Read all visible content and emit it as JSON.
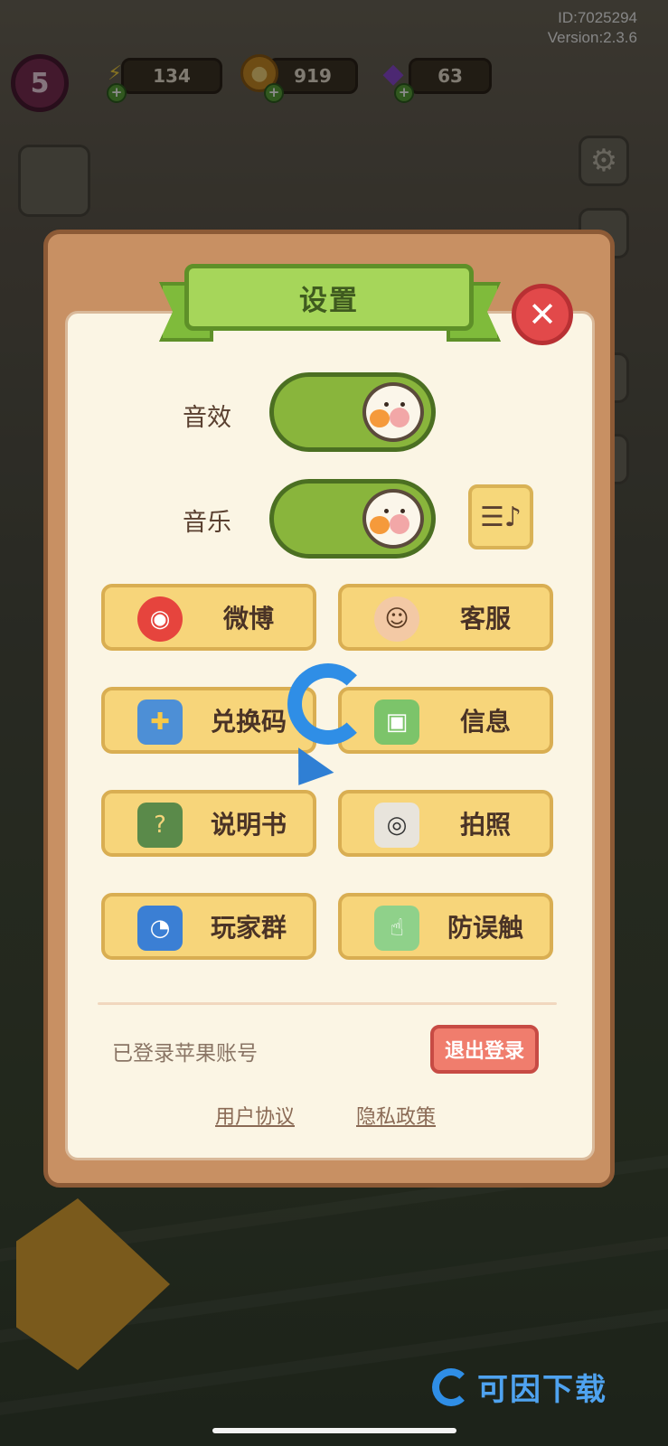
{
  "hud": {
    "id_text": "ID:7025294",
    "version_text": "Version:2.3.6",
    "level": "5",
    "energy": "134",
    "coins": "919",
    "gems": "63"
  },
  "settings": {
    "title": "设置",
    "sound_effects_label": "音效",
    "music_label": "音乐",
    "sound_effects_on": true,
    "music_on": true
  },
  "buttons": [
    {
      "label": "微博",
      "icon": "weibo-icon"
    },
    {
      "label": "客服",
      "icon": "customer-service-icon"
    },
    {
      "label": "兑换码",
      "icon": "gift-icon"
    },
    {
      "label": "信息",
      "icon": "id-card-icon"
    },
    {
      "label": "说明书",
      "icon": "manual-book-icon"
    },
    {
      "label": "拍照",
      "icon": "camera-icon"
    },
    {
      "label": "玩家群",
      "icon": "qq-group-icon"
    },
    {
      "label": "防误触",
      "icon": "touch-guard-icon"
    }
  ],
  "account": {
    "status": "已登录苹果账号",
    "logout_label": "退出登录",
    "user_agreement": "用户协议",
    "privacy_policy": "隐私政策"
  },
  "watermark": {
    "brand_text": "可因下载"
  },
  "colors": {
    "panel_wood": "#c89063",
    "panel_inner": "#fbf5e4",
    "ribbon_green": "#a6d65a",
    "toggle_green": "#89b53c",
    "button_yellow": "#f7d57a",
    "close_red": "#e2494a",
    "logout_red": "#f07d6d"
  }
}
